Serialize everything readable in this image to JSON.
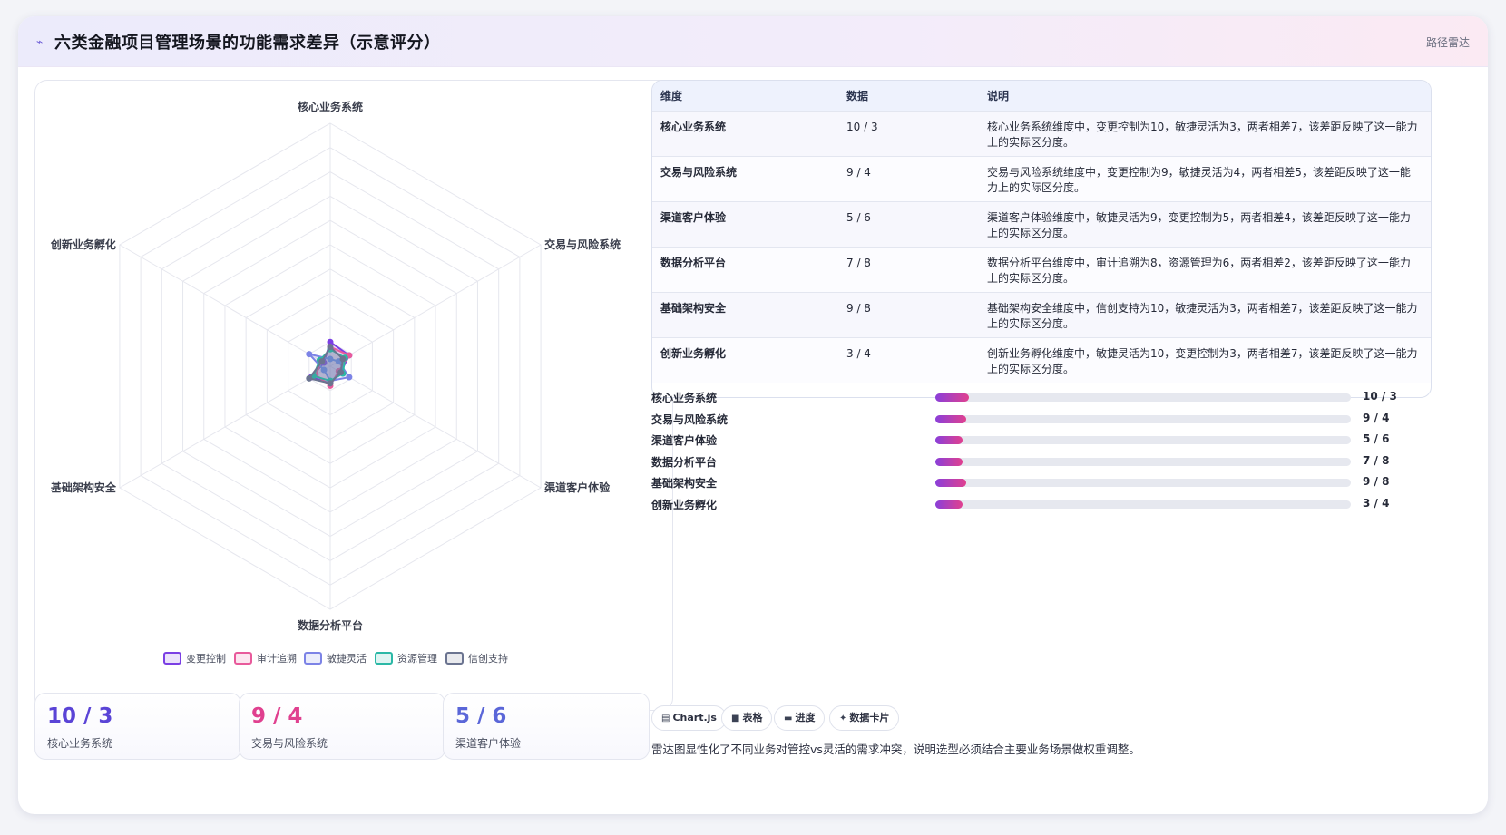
{
  "header": {
    "icon": "trend-line-icon",
    "title": "六类金融项目管理场景的功能需求差异（示意评分）",
    "tag": "路径雷达"
  },
  "chart_data": {
    "type": "radar",
    "axes": [
      "核心业务系统",
      "交易与风险系统",
      "渠道客户体验",
      "数据分析平台",
      "基础架构安全",
      "创新业务孵化"
    ],
    "r_range": [
      0,
      100
    ],
    "grid": true,
    "legend_position": "bottom",
    "series": [
      {
        "name": "变更控制",
        "color": "#7b3fe4",
        "values": [
          10,
          9,
          5,
          7,
          9,
          3
        ]
      },
      {
        "name": "审计追溯",
        "color": "#e85a9b",
        "values": [
          8,
          9,
          4,
          8,
          7,
          4
        ]
      },
      {
        "name": "敏捷灵活",
        "color": "#7c83e6",
        "values": [
          3,
          4,
          9,
          6,
          3,
          10
        ]
      },
      {
        "name": "资源管理",
        "color": "#2bb8a6",
        "values": [
          7,
          7,
          6,
          6,
          8,
          5
        ]
      },
      {
        "name": "信创支持",
        "color": "#6b7490",
        "values": [
          8,
          6,
          5,
          7,
          10,
          4
        ]
      }
    ]
  },
  "table": {
    "headers": [
      "维度",
      "数据",
      "说明"
    ],
    "rows": [
      {
        "dim": "核心业务系统",
        "data": "10 / 3",
        "desc": "核心业务系统维度中，变更控制为10，敏捷灵活为3，两者相差7，该差距反映了这一能力上的实际区分度。"
      },
      {
        "dim": "交易与风险系统",
        "data": "9 / 4",
        "desc": "交易与风险系统维度中，变更控制为9，敏捷灵活为4，两者相差5，该差距反映了这一能力上的实际区分度。"
      },
      {
        "dim": "渠道客户体验",
        "data": "5 / 6",
        "desc": "渠道客户体验维度中，敏捷灵活为9，变更控制为5，两者相差4，该差距反映了这一能力上的实际区分度。"
      },
      {
        "dim": "数据分析平台",
        "data": "7 / 8",
        "desc": "数据分析平台维度中，审计追溯为8，资源管理为6，两者相差2，该差距反映了这一能力上的实际区分度。"
      },
      {
        "dim": "基础架构安全",
        "data": "9 / 8",
        "desc": "基础架构安全维度中，信创支持为10，敏捷灵活为3，两者相差7，该差距反映了这一能力上的实际区分度。"
      },
      {
        "dim": "创新业务孵化",
        "data": "3 / 4",
        "desc": "创新业务孵化维度中，敏捷灵活为10，变更控制为3，两者相差7，该差距反映了这一能力上的实际区分度。"
      }
    ]
  },
  "progress": [
    {
      "label": "核心业务系统",
      "value": "10 / 3",
      "fraction": 0.08
    },
    {
      "label": "交易与风险系统",
      "value": "9 / 4",
      "fraction": 0.075
    },
    {
      "label": "渠道客户体验",
      "value": "5 / 6",
      "fraction": 0.065
    },
    {
      "label": "数据分析平台",
      "value": "7 / 8",
      "fraction": 0.065
    },
    {
      "label": "基础架构安全",
      "value": "9 / 8",
      "fraction": 0.075
    },
    {
      "label": "创新业务孵化",
      "value": "3 / 4",
      "fraction": 0.065
    }
  ],
  "stats": [
    {
      "value": "10 / 3",
      "label": "核心业务系统",
      "color": "#5a44d6"
    },
    {
      "value": "9 / 4",
      "label": "交易与风险系统",
      "color": "#e0408f"
    },
    {
      "value": "5 / 6",
      "label": "渠道客户体验",
      "color": "#5a66d8"
    }
  ],
  "chips": [
    {
      "icon": "chart-icon",
      "glyph": "▤",
      "label": "Chart.js"
    },
    {
      "icon": "table-icon",
      "glyph": "■",
      "label": "表格"
    },
    {
      "icon": "progress-icon",
      "glyph": "▬",
      "label": "进度"
    },
    {
      "icon": "data-card-icon",
      "glyph": "✦",
      "label": "数据卡片"
    }
  ],
  "note": "雷达图显性化了不同业务对管控vs灵活的需求冲突，说明选型必须结合主要业务场景做权重调整。"
}
